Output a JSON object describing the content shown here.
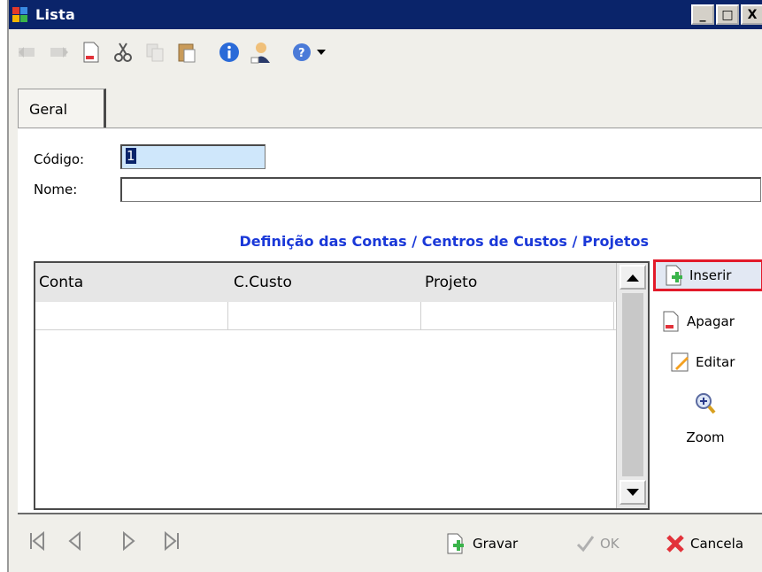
{
  "window": {
    "title": "Lista",
    "controls": [
      "_",
      "□",
      "X"
    ]
  },
  "tabs": [
    {
      "label": "Geral"
    }
  ],
  "form": {
    "codigo_label": "Código:",
    "codigo_value": "1",
    "nome_label": "Nome:",
    "nome_value": ""
  },
  "section_title": "Definição das Contas / Centros de Custos / Projetos",
  "grid": {
    "columns": [
      "Conta",
      "C.Custo",
      "Projeto"
    ]
  },
  "side_buttons": {
    "insert": "Inserir",
    "delete": "Apagar",
    "edit": "Editar",
    "zoom": "Zoom"
  },
  "bottom": {
    "save": "Gravar",
    "ok": "OK",
    "cancel": "Cancela"
  },
  "colors": {
    "titlebar": "#0a246a",
    "section_title": "#1a38d8",
    "highlight": "#e21a2a"
  }
}
